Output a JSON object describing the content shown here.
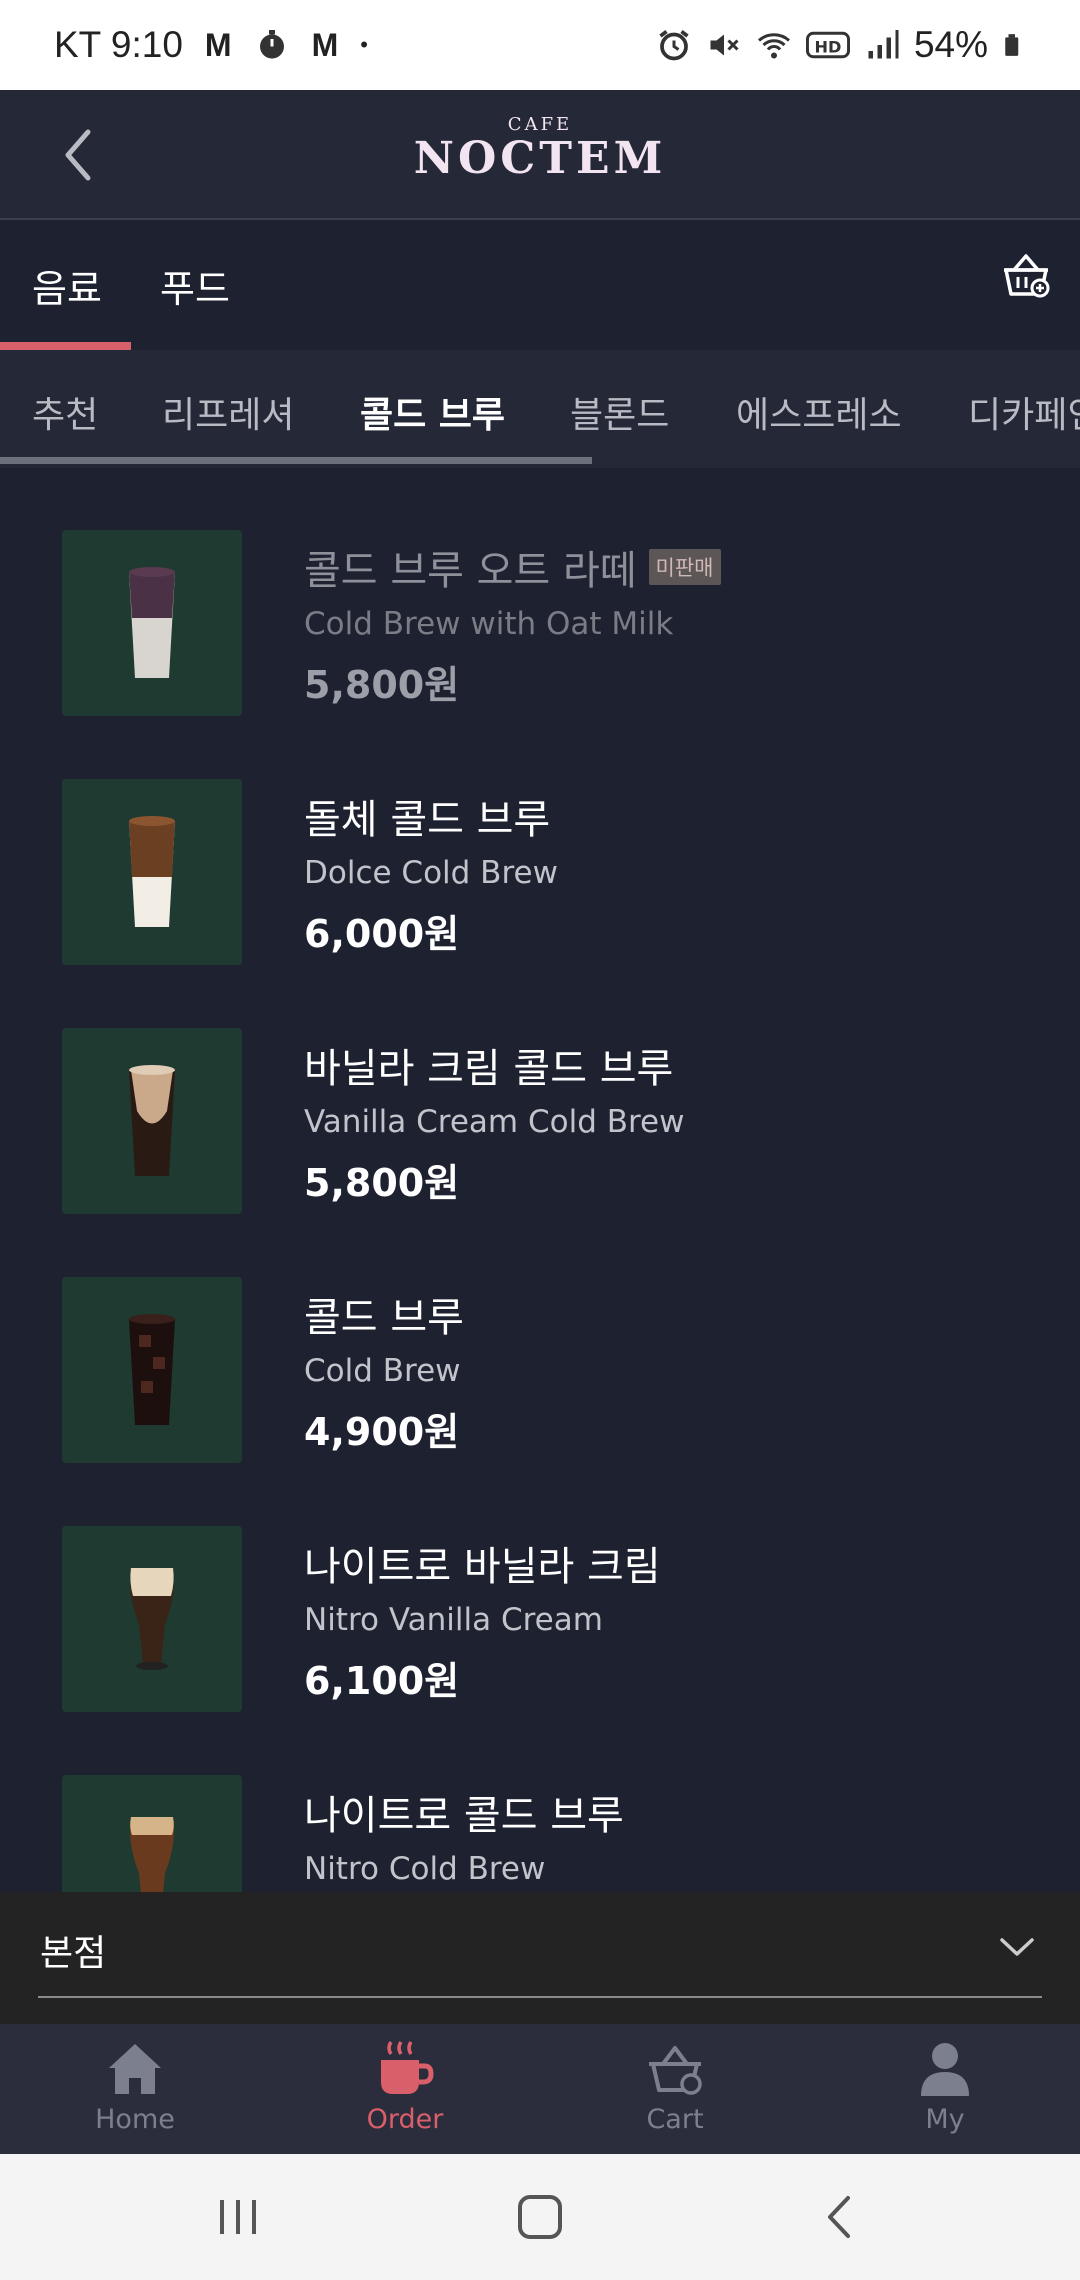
{
  "status_bar": {
    "carrier_time": "KT 9:10",
    "indicators": [
      "M",
      "M"
    ],
    "dot": "•",
    "battery": "54%",
    "icons": [
      "alarm-icon",
      "mute-icon",
      "wifi-icon",
      "hd-icon",
      "signal-icon",
      "battery-icon"
    ]
  },
  "header": {
    "brand_small": "CAFE",
    "brand_big": "NOCTEM"
  },
  "main_tabs": [
    {
      "label": "음료",
      "active": true
    },
    {
      "label": "푸드",
      "active": false
    }
  ],
  "sub_tabs": [
    {
      "label": "추천",
      "active": false
    },
    {
      "label": "리프레셔",
      "active": false
    },
    {
      "label": "콜드 브루",
      "active": true
    },
    {
      "label": "블론드",
      "active": false
    },
    {
      "label": "에스프레소",
      "active": false
    },
    {
      "label": "디카페인",
      "active": false
    }
  ],
  "products": [
    {
      "name": "콜드 브루 오트 라떼",
      "eng": "Cold Brew with Oat Milk",
      "price": "5,800원",
      "badge": "미판매",
      "disabled": true
    },
    {
      "name": "돌체 콜드 브루",
      "eng": "Dolce Cold Brew",
      "price": "6,000원"
    },
    {
      "name": "바닐라 크림 콜드 브루",
      "eng": "Vanilla Cream Cold Brew",
      "price": "5,800원"
    },
    {
      "name": "콜드 브루",
      "eng": "Cold Brew",
      "price": "4,900원"
    },
    {
      "name": "나이트로 바닐라 크림",
      "eng": "Nitro Vanilla Cream",
      "price": "6,100원"
    },
    {
      "name": "나이트로 콜드 브루",
      "eng": "Nitro Cold Brew",
      "price": ""
    }
  ],
  "store": {
    "label": "본점"
  },
  "bottom_nav": [
    {
      "label": "Home",
      "icon": "home-icon",
      "active": false
    },
    {
      "label": "Order",
      "icon": "coffee-cup-icon",
      "active": true
    },
    {
      "label": "Cart",
      "icon": "basket-icon",
      "active": false
    },
    {
      "label": "My",
      "icon": "user-icon",
      "active": false
    }
  ],
  "colors": {
    "background": "#1e2130",
    "header": "#252836",
    "accent": "#d95f6a",
    "thumb_bg": "#1f3a30"
  }
}
